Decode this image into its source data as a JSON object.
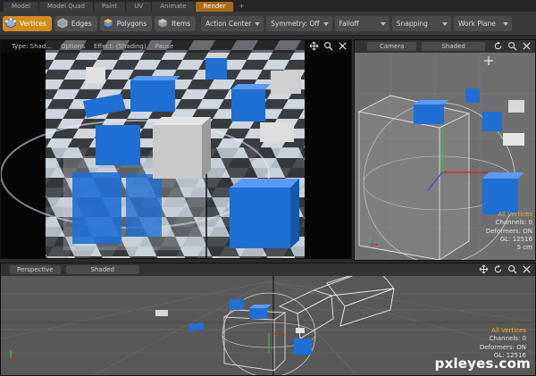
{
  "menu_tabs": [
    "Model",
    "Model Quad",
    "Paint",
    "UV",
    "Animate",
    "Render",
    "+"
  ],
  "active_tab": "Render",
  "toolbar": {
    "modes": [
      {
        "label": "Vertices",
        "active": true,
        "icon": "vertices-icon"
      },
      {
        "label": "Edges",
        "active": false,
        "icon": "edges-icon"
      },
      {
        "label": "Polygons",
        "active": false,
        "icon": "polygons-icon"
      },
      {
        "label": "Items",
        "active": false,
        "icon": "items-icon"
      }
    ],
    "dropdowns": [
      "Action Center",
      "Symmetry: Off",
      "Falloff",
      "Snapping",
      "Work Plane"
    ]
  },
  "render_view": {
    "header": [
      "Type: Shad...",
      "Options",
      "Effect: (Shading)",
      "Pause"
    ]
  },
  "camera_view": {
    "tabs": [
      "Camera",
      "Shaded"
    ],
    "info": {
      "selection": "All Vertices",
      "channels": "Channels: 0",
      "deformers": "Deformers: ON",
      "gl": "GL: 12516",
      "scale": "5 cm"
    }
  },
  "perspective_view": {
    "tabs": [
      "Perspective",
      "Shaded"
    ],
    "info": {
      "selection": "All Vertices",
      "channels": "Channels: 0",
      "deformers": "Deformers: ON",
      "gl": "GL: 12516"
    }
  },
  "watermark": "pxleyes.com",
  "colors": {
    "accent": "#d68a1c",
    "active_tab": "#ad6a16",
    "cube_blue": "#1e6fd0",
    "info_highlight": "#f0b030"
  }
}
